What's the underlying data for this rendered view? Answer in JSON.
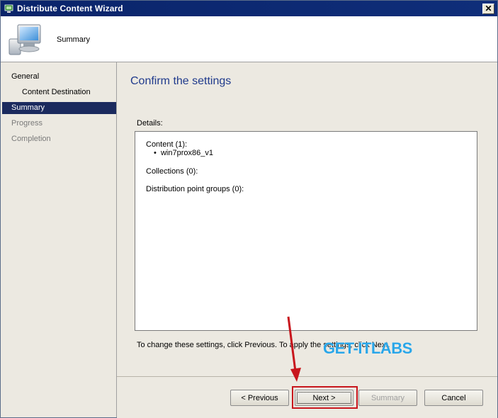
{
  "window": {
    "title": "Distribute Content Wizard",
    "close_glyph": "✕"
  },
  "header": {
    "page_name": "Summary"
  },
  "nav": {
    "items": [
      {
        "label": "General",
        "state": "normal"
      },
      {
        "label": "Content Destination",
        "state": "normal"
      },
      {
        "label": "Summary",
        "state": "selected"
      },
      {
        "label": "Progress",
        "state": "disabled"
      },
      {
        "label": "Completion",
        "state": "disabled"
      }
    ]
  },
  "main": {
    "heading": "Confirm the settings",
    "details_label": "Details:",
    "details": {
      "content_header": "Content (1):",
      "content_items": [
        "win7prox86_v1"
      ],
      "collections_header": "Collections (0):",
      "dp_groups_header": "Distribution point groups (0):"
    },
    "hint": "To change these settings, click Previous. To apply the settings, click Next."
  },
  "overlay": {
    "watermark": "GET-ITLABS",
    "annotation_color": "#c8161d"
  },
  "buttons": {
    "previous": "< Previous",
    "next": "Next >",
    "summary": "Summary",
    "cancel": "Cancel"
  },
  "icons": {
    "title": "wizard-icon",
    "header": "computer-icon",
    "close": "close-icon"
  }
}
